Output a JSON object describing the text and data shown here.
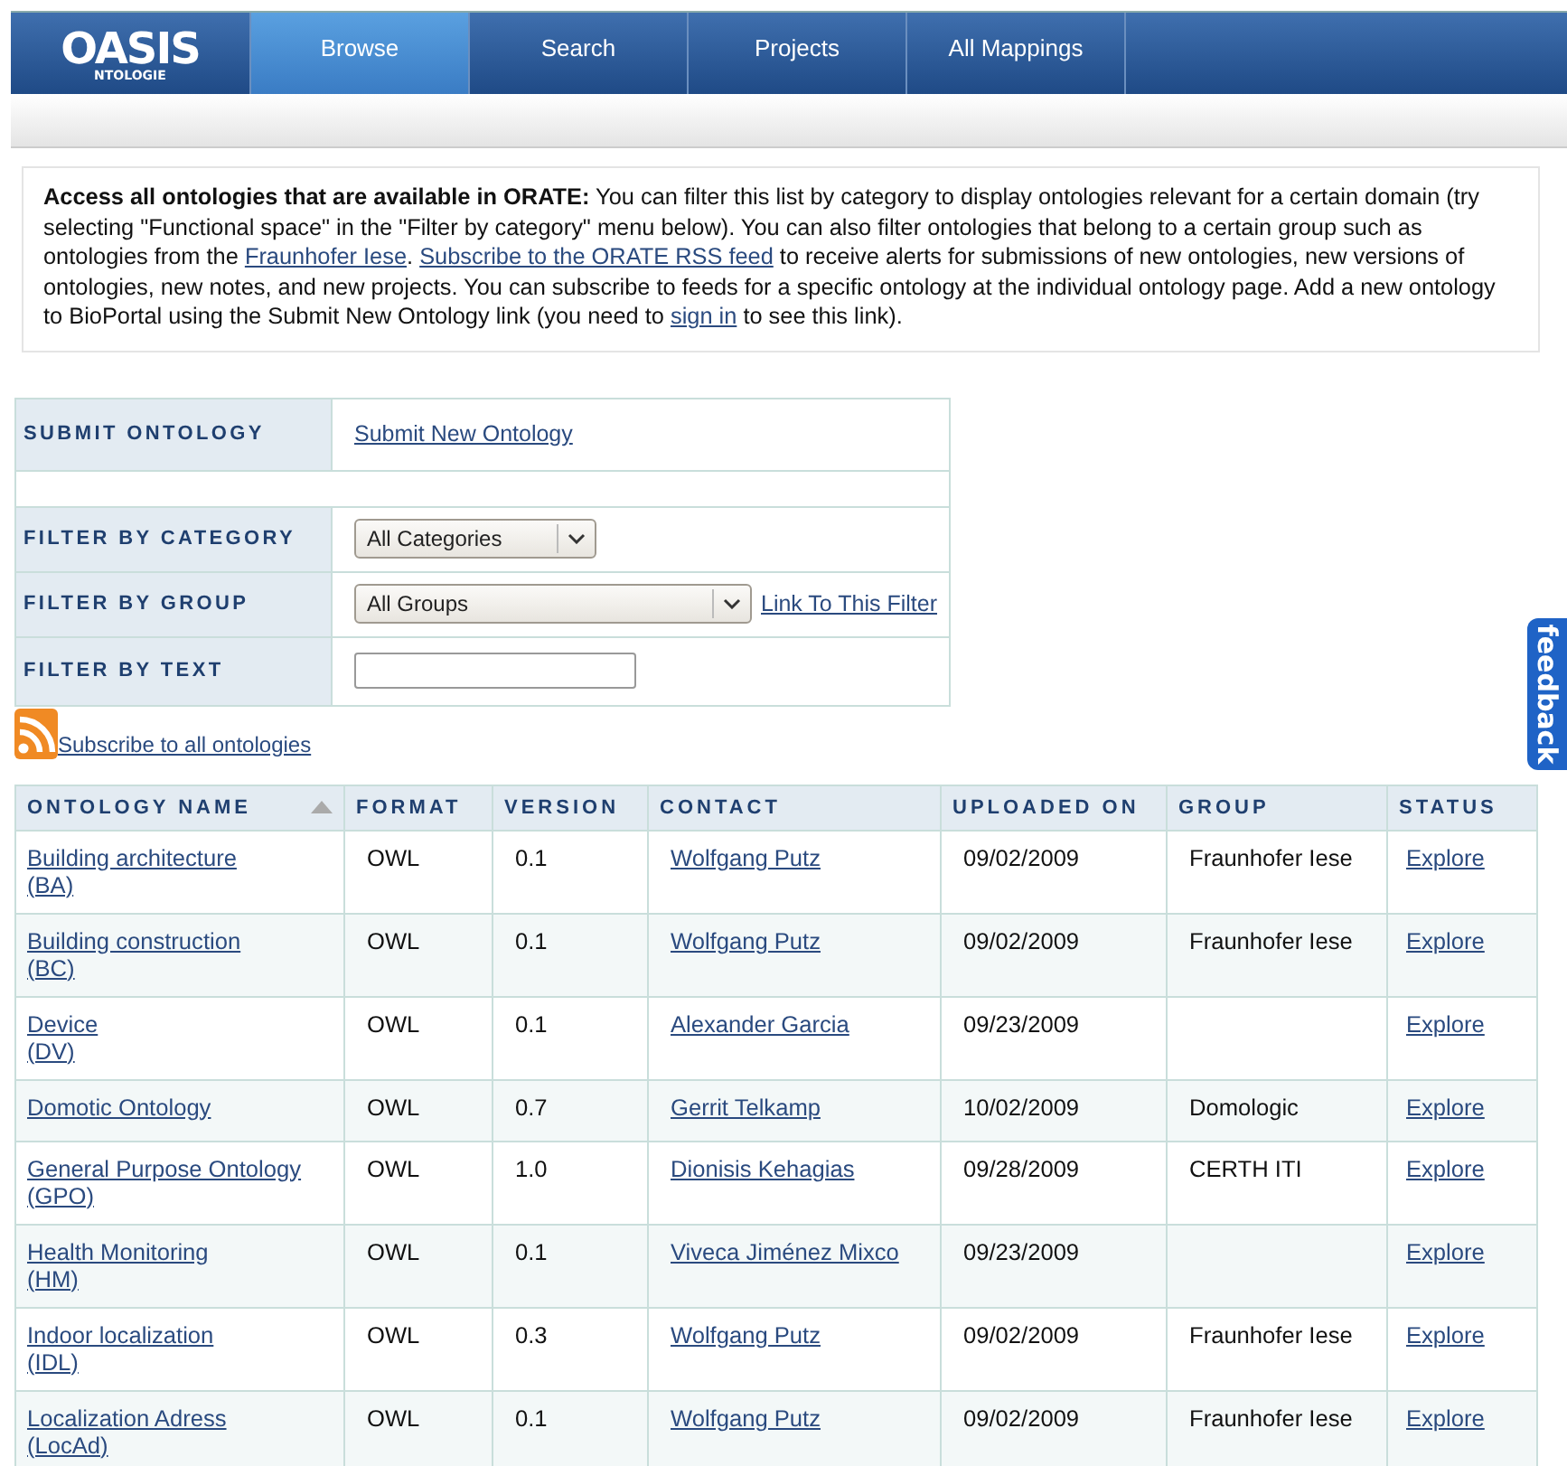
{
  "logo": {
    "title": "OASIS",
    "subtitle": "NTOLOGIE"
  },
  "nav_tabs": [
    {
      "label": "Browse",
      "selected": true
    },
    {
      "label": "Search",
      "selected": false
    },
    {
      "label": "Projects",
      "selected": false
    },
    {
      "label": "All Mappings",
      "selected": false
    }
  ],
  "intro": [
    {
      "kind": "text",
      "text": "**Access all ontologies that are available in ORATE:** You can filter this list by category to display ontologies relevant for a certain domain (try selecting \"Functional space\" in the \"Filter by category\" menu below). You can also filter ontologies that belong to a certain group such as ontologies from the "
    },
    {
      "kind": "link",
      "text": "Fraunhofer Iese"
    },
    {
      "kind": "text",
      "text": ". "
    },
    {
      "kind": "link",
      "text": "Subscribe to the ORATE RSS feed"
    },
    {
      "kind": "text",
      "text": " to receive alerts for submissions of new ontologies, new versions of ontologies, new notes, and new projects. You can subscribe to feeds for a specific ontology at the individual ontology page. Add a new ontology to BioPortal using the Submit New Ontology link (you need to "
    },
    {
      "kind": "link",
      "text": "sign in"
    },
    {
      "kind": "text",
      "text": " to see this link)."
    }
  ],
  "filters": [
    {
      "kind": "link",
      "label": "SUBMIT ONTOLOGY",
      "value": "Submit New Ontology"
    },
    {
      "kind": "blank"
    },
    {
      "kind": "select",
      "label": "FILTER BY CATEGORY",
      "value": "All Categories"
    },
    {
      "kind": "select",
      "label": "FILTER BY GROUP",
      "value": "All Groups",
      "link": "Link To This Filter"
    },
    {
      "kind": "text",
      "label": "FILTER BY TEXT"
    }
  ],
  "subscribe_link": "Subscribe to all ontologies",
  "table": {
    "columns": [
      {
        "label": "ONTOLOGY NAME",
        "sorted": true
      },
      {
        "label": "FORMAT",
        "sorted": false
      },
      {
        "label": "VERSION",
        "sorted": false
      },
      {
        "label": "CONTACT",
        "sorted": false
      },
      {
        "label": "UPLOADED ON",
        "sorted": false
      },
      {
        "label": "GROUP",
        "sorted": false
      },
      {
        "label": "STATUS",
        "sorted": false
      }
    ],
    "rows": [
      {
        "name": "Building architecture",
        "acronym": "(BA)",
        "format": "OWL",
        "version": "0.1",
        "contact": "Wolfgang Putz",
        "uploaded": "09/02/2009",
        "group": "Fraunhofer Iese",
        "status": "Explore"
      },
      {
        "name": "Building construction",
        "acronym": "(BC)",
        "format": "OWL",
        "version": "0.1",
        "contact": "Wolfgang Putz",
        "uploaded": "09/02/2009",
        "group": "Fraunhofer Iese",
        "status": "Explore"
      },
      {
        "name": "Device",
        "acronym": "(DV)",
        "format": "OWL",
        "version": "0.1",
        "contact": "Alexander Garcia",
        "uploaded": "09/23/2009",
        "status": "Explore"
      },
      {
        "name": "Domotic Ontology",
        "format": "OWL",
        "version": "0.7",
        "contact": "Gerrit Telkamp",
        "uploaded": "10/02/2009",
        "group": "Domologic",
        "status": "Explore"
      },
      {
        "name": "General Purpose Ontology",
        "acronym": "(GPO)",
        "format": "OWL",
        "version": "1.0",
        "contact": "Dionisis Kehagias",
        "uploaded": "09/28/2009",
        "group": "CERTH ITI",
        "status": "Explore"
      },
      {
        "name": "Health Monitoring",
        "acronym": "(HM)",
        "format": "OWL",
        "version": "0.1",
        "contact": "Viveca Jiménez Mixco",
        "uploaded": "09/23/2009",
        "status": "Explore"
      },
      {
        "name": "Indoor localization",
        "acronym": "(IDL)",
        "format": "OWL",
        "version": "0.3",
        "contact": "Wolfgang Putz",
        "uploaded": "09/02/2009",
        "group": "Fraunhofer Iese",
        "status": "Explore"
      },
      {
        "name": "Localization Adress",
        "acronym": "(LocAd)",
        "format": "OWL",
        "version": "0.1",
        "contact": "Wolfgang Putz",
        "uploaded": "09/02/2009",
        "group": "Fraunhofer Iese",
        "status": "Explore"
      }
    ]
  },
  "feedback_tab": "feedback"
}
